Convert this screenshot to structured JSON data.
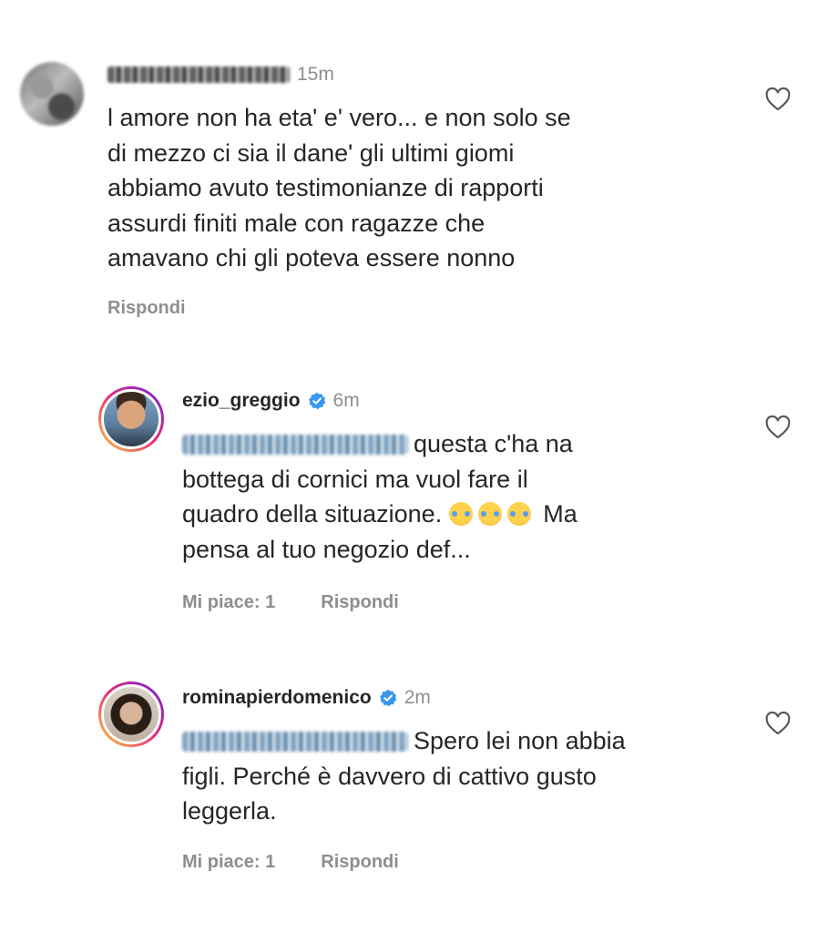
{
  "comments": [
    {
      "username": "",
      "time": "15m",
      "verified": false,
      "text_lines": [
        "l amore non ha eta' e' vero... e non solo se",
        "di mezzo ci sia il dane'  gli ultimi giomi",
        "abbiamo avuto testimonianze di rapporti",
        "assurdi finiti male con ragazze che",
        "amavano chi gli poteva essere nonno"
      ],
      "reply_label": "Rispondi"
    },
    {
      "username": "ezio_greggio",
      "time": "6m",
      "verified": true,
      "text_lines": [
        "questa c'ha na",
        "bottega di cornici ma vuol fare il",
        "quadro della situazione.",
        "Ma",
        "pensa al tuo negozio def..."
      ],
      "likes_label": "Mi piace: 1",
      "reply_label": "Rispondi"
    },
    {
      "username": "rominapierdomenico",
      "time": "2m",
      "verified": true,
      "text_lines": [
        "Spero lei non abbia",
        "figli. Perché è davvero di cattivo gusto",
        "leggerla."
      ],
      "likes_label": "Mi piace: 1",
      "reply_label": "Rispondi"
    }
  ],
  "colors": {
    "text": "#262626",
    "muted": "#8e8e8e",
    "verified": "#3897f0"
  },
  "icons": {
    "like": "heart-outline-icon",
    "verified": "verified-badge-icon",
    "emoji": "face-with-tears-of-joy-icon"
  }
}
